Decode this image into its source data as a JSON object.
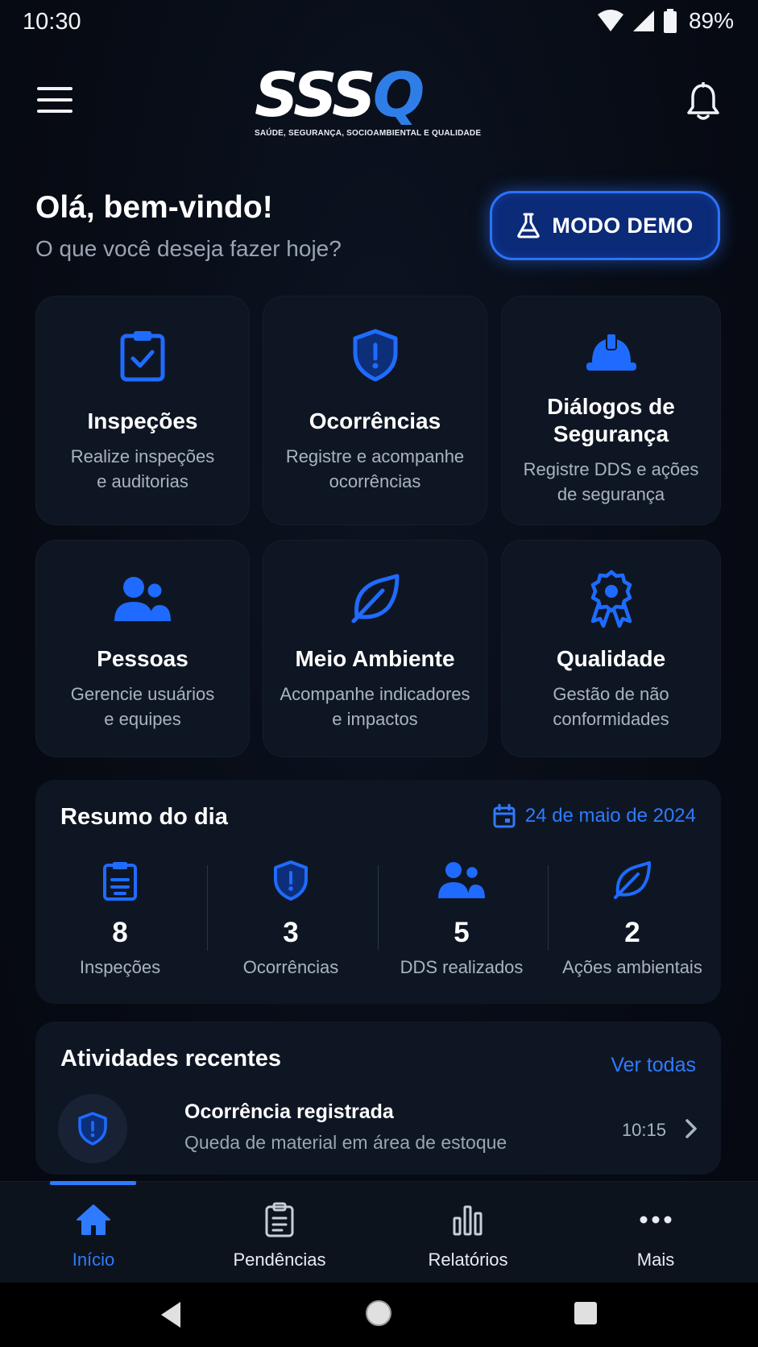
{
  "status_bar": {
    "time": "10:30",
    "battery": "89%"
  },
  "header": {
    "logo_part_white": "SSS",
    "logo_part_blue": "Q",
    "logo_subtitle": "SAÚDE, SEGURANÇA, SOCIOAMBIENTAL E QUALIDADE",
    "menu_icon": "hamburger-icon",
    "bell_icon": "bell-icon"
  },
  "greeting": {
    "title": "Olá, bem-vindo!",
    "subtitle": "O que você deseja fazer hoje?",
    "demo_button": "MODO DEMO"
  },
  "tiles": [
    {
      "title": "Inspeções",
      "desc1": "Realize inspeções",
      "desc2": "e auditorias",
      "icon": "clipboard-check-icon"
    },
    {
      "title": "Ocorrências",
      "desc1": "Registre e acompanhe",
      "desc2": "ocorrências",
      "icon": "shield-alert-icon"
    },
    {
      "title1": "Diálogos de",
      "title2": "Segurança",
      "desc1": "Registre DDS e ações",
      "desc2": "de segurança",
      "icon": "hard-hat-icon"
    },
    {
      "title": "Pessoas",
      "desc1": "Gerencie usuários",
      "desc2": "e equipes",
      "icon": "users-icon"
    },
    {
      "title": "Meio Ambiente",
      "desc1": "Acompanhe indicadores",
      "desc2": "e impactos",
      "icon": "leaf-icon"
    },
    {
      "title": "Qualidade",
      "desc1": "Gestão de não",
      "desc2": "conformidades",
      "icon": "award-icon"
    }
  ],
  "summary": {
    "title": "Resumo do dia",
    "date": "24 de maio de 2024",
    "stats": [
      {
        "value": "8",
        "label": "Inspeções",
        "icon": "clipboard-icon"
      },
      {
        "value": "3",
        "label": "Ocorrências",
        "icon": "shield-alert-icon"
      },
      {
        "value": "5",
        "label": "DDS realizados",
        "icon": "users-icon"
      },
      {
        "value": "2",
        "label": "Ações ambientais",
        "icon": "leaf-icon"
      }
    ]
  },
  "activities": {
    "title": "Atividades recentes",
    "see_all": "Ver todas",
    "items": [
      {
        "title": "Ocorrência registrada",
        "desc": "Queda de material em área de estoque",
        "time": "10:15",
        "icon": "shield-alert-icon"
      }
    ]
  },
  "bottom_nav": [
    {
      "label": "Início",
      "icon": "home-icon",
      "active": true
    },
    {
      "label": "Pendências",
      "icon": "clipboard-list-icon"
    },
    {
      "label": "Relatórios",
      "icon": "bar-chart-icon"
    },
    {
      "label": "Mais",
      "icon": "more-icon"
    }
  ],
  "colors": {
    "accent": "#2e7bff",
    "background": "#070b14",
    "card": "#0f1623",
    "icon_blue": "#1f6bff"
  }
}
